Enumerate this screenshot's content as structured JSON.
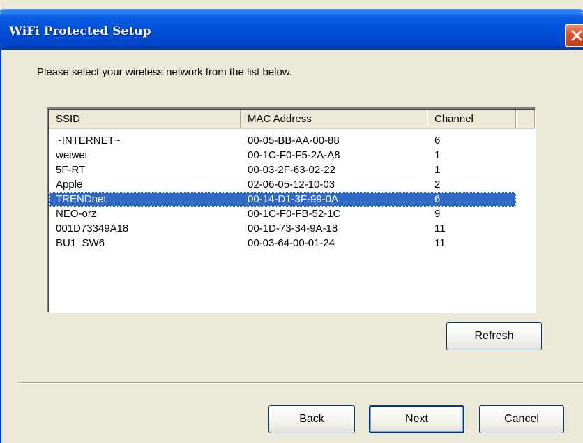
{
  "window": {
    "title": "WiFi Protected Setup"
  },
  "instruction": "Please select your wireless network from the list below.",
  "network_list": {
    "columns": [
      "SSID",
      "MAC Address",
      "Channel"
    ],
    "rows": [
      {
        "ssid": "~INTERNET~",
        "mac": "00-05-BB-AA-00-88",
        "channel": "6",
        "selected": false
      },
      {
        "ssid": "weiwei",
        "mac": "00-1C-F0-F5-2A-A8",
        "channel": "1",
        "selected": false
      },
      {
        "ssid": "5F-RT",
        "mac": "00-03-2F-63-02-22",
        "channel": "1",
        "selected": false
      },
      {
        "ssid": "Apple",
        "mac": "02-06-05-12-10-03",
        "channel": "2",
        "selected": false
      },
      {
        "ssid": "TRENDnet",
        "mac": "00-14-D1-3F-99-0A",
        "channel": "6",
        "selected": true
      },
      {
        "ssid": "NEO-orz",
        "mac": "00-1C-F0-FB-52-1C",
        "channel": "9",
        "selected": false
      },
      {
        "ssid": "001D73349A18",
        "mac": "00-1D-73-34-9A-18",
        "channel": "11",
        "selected": false
      },
      {
        "ssid": "BU1_SW6",
        "mac": "00-03-64-00-01-24",
        "channel": "11",
        "selected": false
      }
    ]
  },
  "buttons": {
    "refresh": "Refresh",
    "back": "Back",
    "next": "Next",
    "cancel": "Cancel"
  },
  "colors": {
    "titlebar": "#0050d8",
    "selection": "#316ac5",
    "close_button": "#d9502b",
    "dialog_face": "#ece9d8"
  },
  "icons": {
    "close": "close-icon"
  }
}
